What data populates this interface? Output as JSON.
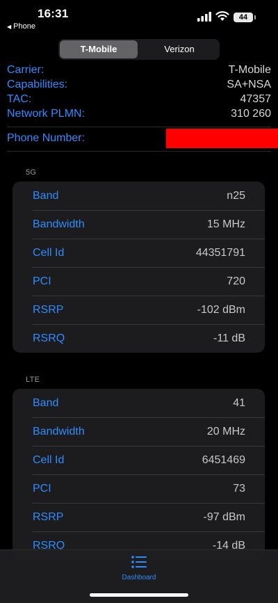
{
  "status_bar": {
    "time": "16:31",
    "back_label": "Phone",
    "battery": "44",
    "signal_icon": "signal-bars-icon",
    "wifi_icon": "wifi-icon"
  },
  "segmented": {
    "options": [
      "T-Mobile",
      "Verizon"
    ],
    "selected": "T-Mobile"
  },
  "info": [
    {
      "label": "Carrier:",
      "value": "T-Mobile"
    },
    {
      "label": "Capabilities:",
      "value": "SA+NSA"
    },
    {
      "label": "TAC:",
      "value": "47357"
    },
    {
      "label": "Network PLMN:",
      "value": "310 260"
    }
  ],
  "phone_number": {
    "label": "Phone Number:"
  },
  "sections": [
    {
      "title": "5G",
      "rows": [
        {
          "label": "Band",
          "value": "n25"
        },
        {
          "label": "Bandwidth",
          "value": "15 MHz"
        },
        {
          "label": "Cell Id",
          "value": "44351791"
        },
        {
          "label": "PCI",
          "value": "720"
        },
        {
          "label": "RSRP",
          "value": "-102 dBm"
        },
        {
          "label": "RSRQ",
          "value": "-11 dB"
        }
      ]
    },
    {
      "title": "LTE",
      "rows": [
        {
          "label": "Band",
          "value": "41"
        },
        {
          "label": "Bandwidth",
          "value": "20 MHz"
        },
        {
          "label": "Cell Id",
          "value": "6451469"
        },
        {
          "label": "PCI",
          "value": "73"
        },
        {
          "label": "RSRP",
          "value": "-97 dBm"
        },
        {
          "label": "RSRQ",
          "value": "-14 dB"
        }
      ]
    }
  ],
  "tab_bar": {
    "items": [
      {
        "label": "Dashboard",
        "icon": "list-icon"
      }
    ]
  },
  "colors": {
    "accent": "#2f8cff",
    "redaction": "#ff0000"
  }
}
